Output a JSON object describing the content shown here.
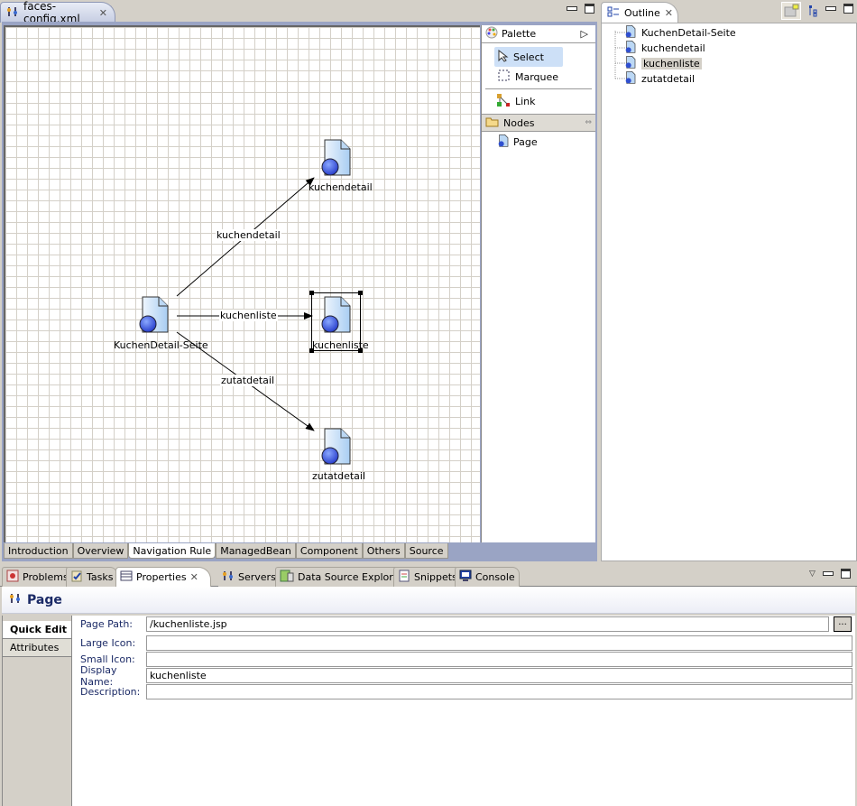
{
  "editor": {
    "tab_title": "faces-config.xml",
    "tab_icon": "faces-config-icon",
    "page_tabs": [
      {
        "label": "Introduction",
        "active": false
      },
      {
        "label": "Overview",
        "active": false
      },
      {
        "label": "Navigation Rule",
        "active": true
      },
      {
        "label": "ManagedBean",
        "active": false
      },
      {
        "label": "Component",
        "active": false
      },
      {
        "label": "Others",
        "active": false
      },
      {
        "label": "Source",
        "active": false
      }
    ]
  },
  "palette": {
    "title": "Palette",
    "tools": [
      {
        "label": "Select",
        "icon": "arrow-cursor-icon",
        "selected": true
      },
      {
        "label": "Marquee",
        "icon": "marquee-icon",
        "selected": false
      },
      {
        "label": "Link",
        "icon": "link-icon",
        "selected": false
      }
    ],
    "drawer": {
      "title": "Nodes",
      "items": [
        {
          "label": "Page",
          "icon": "page-icon"
        }
      ]
    }
  },
  "diagram": {
    "nodes": [
      {
        "id": "kuchendetail-seite",
        "label": "KuchenDetail-Seite",
        "selected": false
      },
      {
        "id": "kuchendetail",
        "label": "kuchendetail",
        "selected": false
      },
      {
        "id": "kuchenliste",
        "label": "kuchenliste",
        "selected": true
      },
      {
        "id": "zutatdetail",
        "label": "zutatdetail",
        "selected": false
      }
    ],
    "edges": [
      {
        "from": "KuchenDetail-Seite",
        "to": "kuchendetail",
        "label": "kuchendetail"
      },
      {
        "from": "KuchenDetail-Seite",
        "to": "kuchenliste",
        "label": "kuchenliste"
      },
      {
        "from": "KuchenDetail-Seite",
        "to": "zutatdetail",
        "label": "zutatdetail"
      }
    ]
  },
  "outline": {
    "title": "Outline",
    "items": [
      {
        "label": "KuchenDetail-Seite",
        "selected": false
      },
      {
        "label": "kuchendetail",
        "selected": false
      },
      {
        "label": "kuchenliste",
        "selected": true
      },
      {
        "label": "zutatdetail",
        "selected": false
      }
    ]
  },
  "bottom": {
    "tabs": [
      {
        "label": "Problems",
        "icon": "problems-icon",
        "active": false
      },
      {
        "label": "Tasks",
        "icon": "tasks-icon",
        "active": false
      },
      {
        "label": "Properties",
        "icon": "properties-icon",
        "active": true
      },
      {
        "label": "Servers",
        "icon": "servers-icon",
        "active": false
      },
      {
        "label": "Data Source Explorer",
        "icon": "data-source-icon",
        "active": false
      },
      {
        "label": "Snippets",
        "icon": "snippets-icon",
        "active": false
      },
      {
        "label": "Console",
        "icon": "console-icon",
        "active": false
      }
    ],
    "properties": {
      "title": "Page",
      "side_tabs": [
        {
          "label": "Quick Edit",
          "active": true
        },
        {
          "label": "Attributes",
          "active": false
        }
      ],
      "fields": [
        {
          "label": "Page Path:",
          "value": "/kuchenliste.jsp"
        },
        {
          "label": "Large Icon:",
          "value": ""
        },
        {
          "label": "Small Icon:",
          "value": ""
        },
        {
          "label": "Display Name:",
          "value": "kuchenliste"
        },
        {
          "label": "Description:",
          "value": ""
        }
      ],
      "browse_label": "..."
    }
  }
}
